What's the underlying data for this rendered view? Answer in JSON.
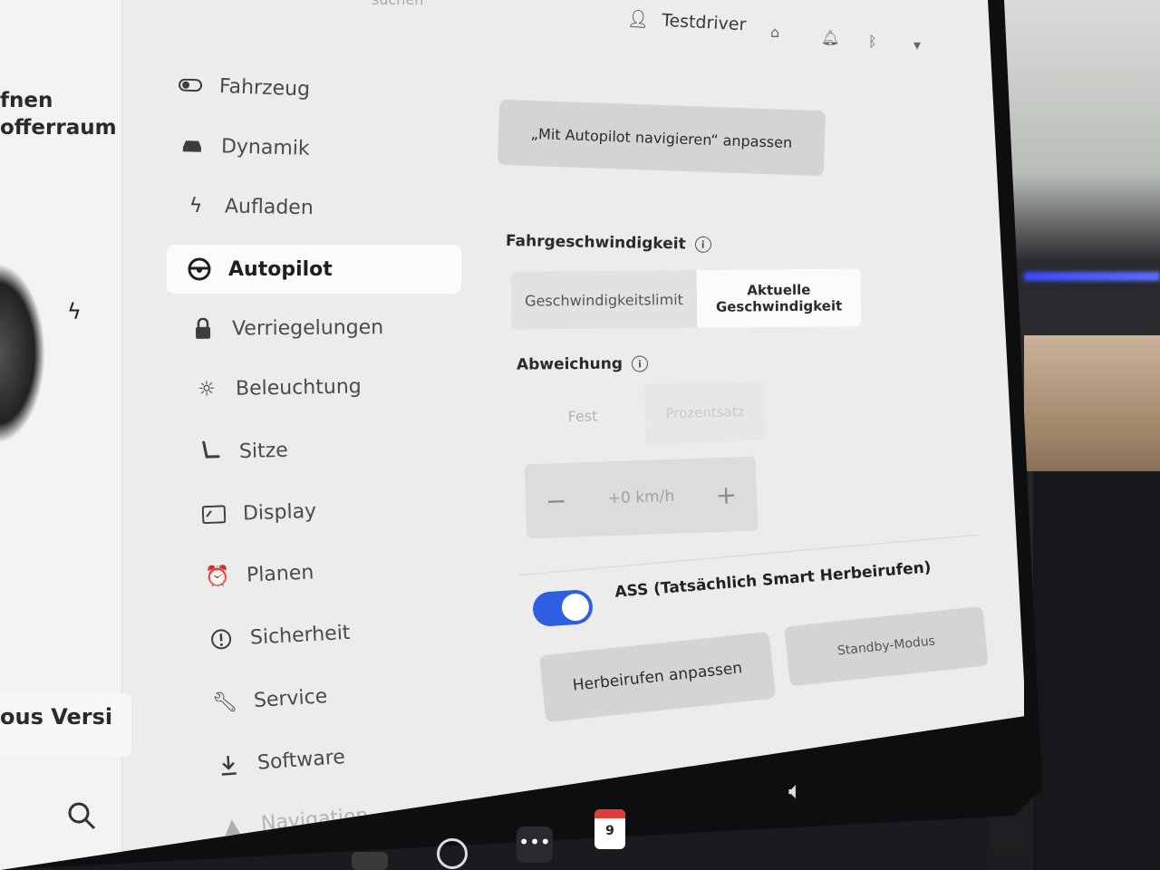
{
  "car_panel": {
    "line1": "fnen",
    "line2": "offerraum",
    "version_text": "ous Versi"
  },
  "sidebar": {
    "items": [
      {
        "label": "Fahrzeug",
        "icon": "toggle-icon"
      },
      {
        "label": "Dynamik",
        "icon": "car-icon"
      },
      {
        "label": "Aufladen",
        "icon": "bolt-icon"
      },
      {
        "label": "Autopilot",
        "icon": "steering-wheel-icon",
        "active": true
      },
      {
        "label": "Verriegelungen",
        "icon": "lock-icon"
      },
      {
        "label": "Beleuchtung",
        "icon": "sun-icon"
      },
      {
        "label": "Sitze",
        "icon": "seat-icon"
      },
      {
        "label": "Display",
        "icon": "display-icon"
      },
      {
        "label": "Planen",
        "icon": "alarm-clock-icon"
      },
      {
        "label": "Sicherheit",
        "icon": "alert-circle-icon"
      },
      {
        "label": "Service",
        "icon": "wrench-icon"
      },
      {
        "label": "Software",
        "icon": "download-icon"
      },
      {
        "label": "Navigation",
        "icon": "navigation-icon"
      }
    ]
  },
  "topbar": {
    "search_ghost": "suchen",
    "user_name": "Testdriver"
  },
  "content": {
    "nav_button_label": "„Mit Autopilot navigieren“ anpassen",
    "speed_section": "Fahrgeschwindigkeit",
    "speed_options": [
      "Geschwindigkeitslimit",
      "Aktuelle Geschwindigkeit"
    ],
    "speed_selected": "Aktuelle Geschwindigkeit",
    "offset_section": "Abweichung",
    "offset_options": [
      "Fest",
      "Prozentsatz"
    ],
    "offset_value": "+0 km/h",
    "toggle_label": "ASS (Tatsächlich Smart Herbeirufen)",
    "toggle_on": true,
    "summon_button": "Herbeirufen anpassen",
    "standby_button": "Standby-Modus"
  },
  "dock": {
    "calendar_day": "9",
    "more_label": "•••"
  },
  "colors": {
    "accent_toggle": "#2f5fe0",
    "screen_bg": "#ececec",
    "active_item_bg": "#fbfbfb"
  }
}
